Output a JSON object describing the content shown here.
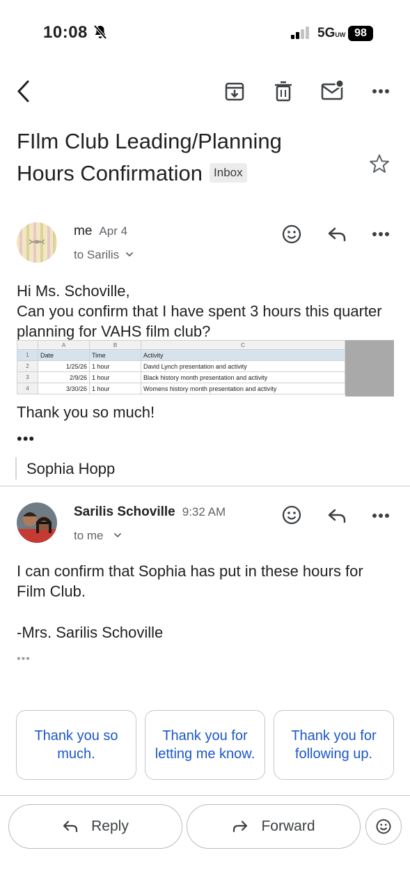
{
  "status_bar": {
    "time": "10:08",
    "network": "5G",
    "network_sub": "UW",
    "battery": "98"
  },
  "toolbar": {
    "icons": [
      "back-icon",
      "archive-icon",
      "trash-icon",
      "mark-unread-icon",
      "more-icon"
    ]
  },
  "subject": {
    "text": "FIlm Club Leading/Planning Hours Confirmation",
    "label": "Inbox"
  },
  "message1": {
    "sender": "me",
    "date": "Apr 4",
    "to": "to Sarilis",
    "greeting": "Hi Ms. Schoville,",
    "body": "Can you confirm that I have spent 3 hours this quarter planning for VAHS film club?",
    "sheet": {
      "col_letters": [
        "A",
        "B",
        "C"
      ],
      "headers": [
        "Date",
        "Time",
        "Activity"
      ],
      "rows": [
        {
          "n": "1",
          "date": "Date",
          "time": "Time",
          "activity": "Activity"
        },
        {
          "n": "2",
          "date": "1/25/26",
          "time": "1 hour",
          "activity": "David Lynch presentation and activity"
        },
        {
          "n": "3",
          "date": "2/9/26",
          "time": "1 hour",
          "activity": "Black history month presentation and activity"
        },
        {
          "n": "4",
          "date": "3/30/26",
          "time": "1 hour",
          "activity": "Womens history month presentation and activity"
        }
      ]
    },
    "closing": "Thank you so much!",
    "ellipsis": "•••",
    "signature": "Sophia Hopp"
  },
  "message2": {
    "sender": "Sarilis Schoville",
    "time": "9:32 AM",
    "to": "to me",
    "body": "I can confirm that Sophia has put in these hours for Film Club.",
    "signature": "-Mrs. Sarilis Schoville",
    "ellipsis": "•••"
  },
  "smart_replies": [
    "Thank you so much.",
    "Thank you for letting me know.",
    "Thank you for following up."
  ],
  "actions": {
    "reply": "Reply",
    "forward": "Forward"
  },
  "colors": {
    "accent": "#1a57c8",
    "text": "#1f1f1f",
    "secondary": "#5f6368"
  }
}
